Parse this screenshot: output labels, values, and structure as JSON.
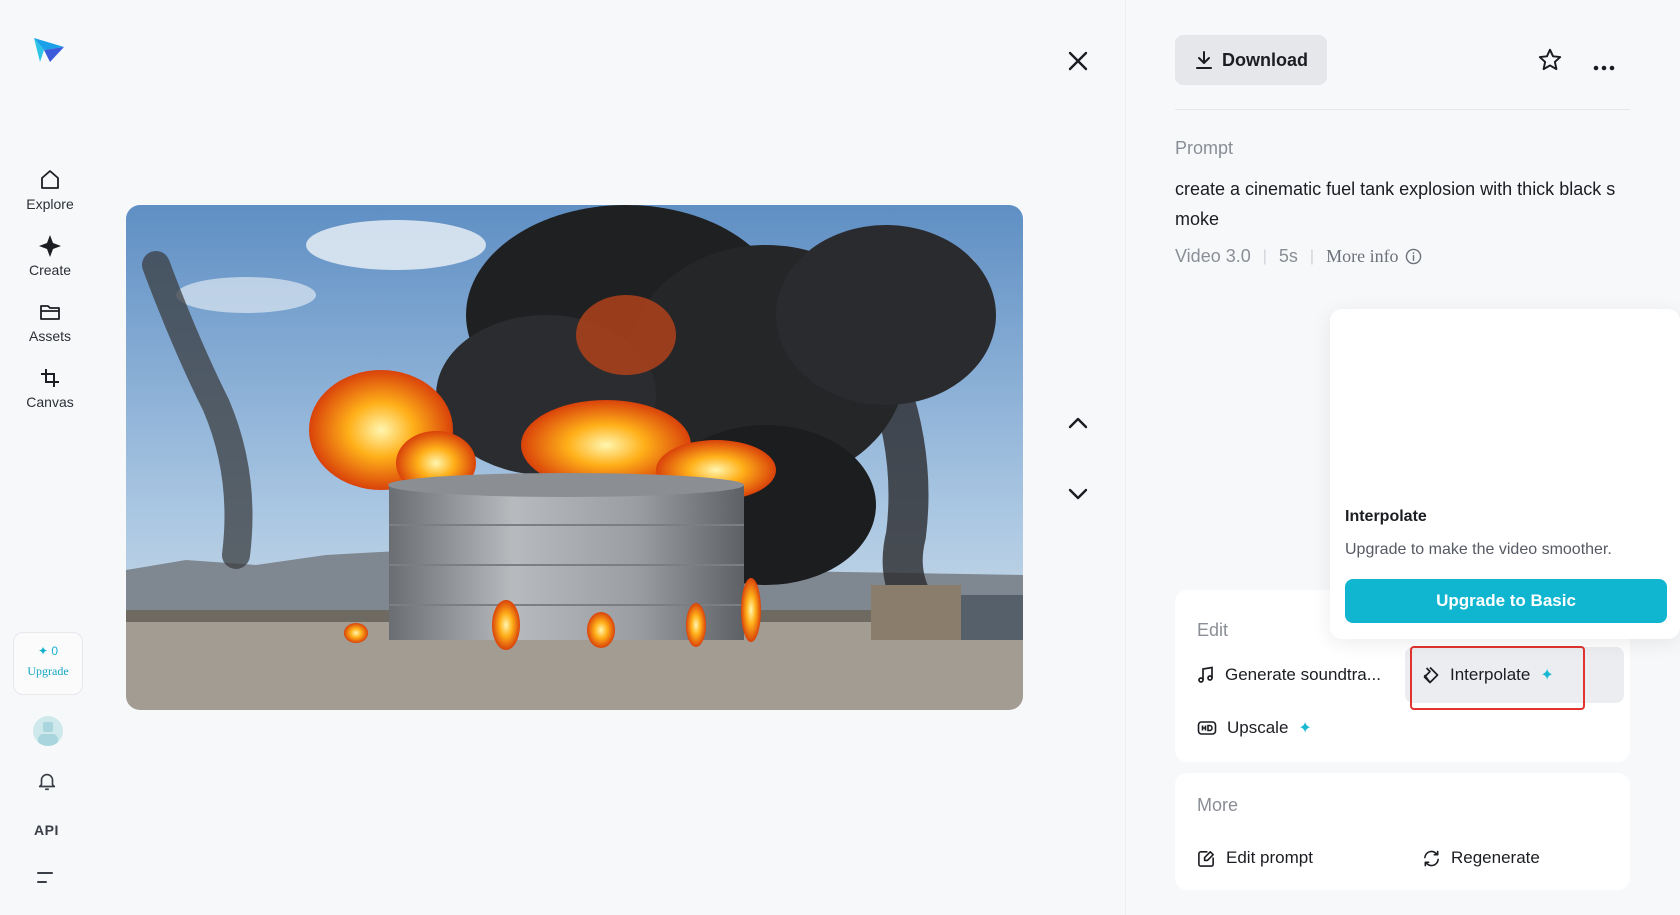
{
  "sidebar": {
    "items": [
      {
        "label": "Explore",
        "icon": "home-icon"
      },
      {
        "label": "Create",
        "icon": "sparkle-icon"
      },
      {
        "label": "Assets",
        "icon": "folder-icon"
      },
      {
        "label": "Canvas",
        "icon": "crop-icon"
      }
    ],
    "credits": "0",
    "upgrade_label": "Upgrade",
    "api_label": "API"
  },
  "toolbar": {
    "download_label": "Download"
  },
  "prompt": {
    "title": "Prompt",
    "text": "create a cinematic fuel tank explosion with thick black s moke",
    "model": "Video 3.0",
    "duration": "5s",
    "more_info_label": "More info"
  },
  "popover": {
    "title": "Interpolate",
    "description": "Upgrade to make the video smoother.",
    "button_label": "Upgrade to Basic"
  },
  "edit": {
    "title": "Edit",
    "actions": [
      {
        "label": "Generate soundtra...",
        "icon": "music-note-icon"
      },
      {
        "label": "Interpolate",
        "icon": "diamond-interpolate-icon"
      },
      {
        "label": "Upscale",
        "icon": "hd-icon"
      }
    ]
  },
  "more": {
    "title": "More",
    "actions": [
      {
        "label": "Edit prompt",
        "icon": "edit-icon"
      },
      {
        "label": "Regenerate",
        "icon": "refresh-icon"
      }
    ]
  },
  "colors": {
    "accent": "#10b6cf",
    "highlight_border": "#e2332f"
  }
}
